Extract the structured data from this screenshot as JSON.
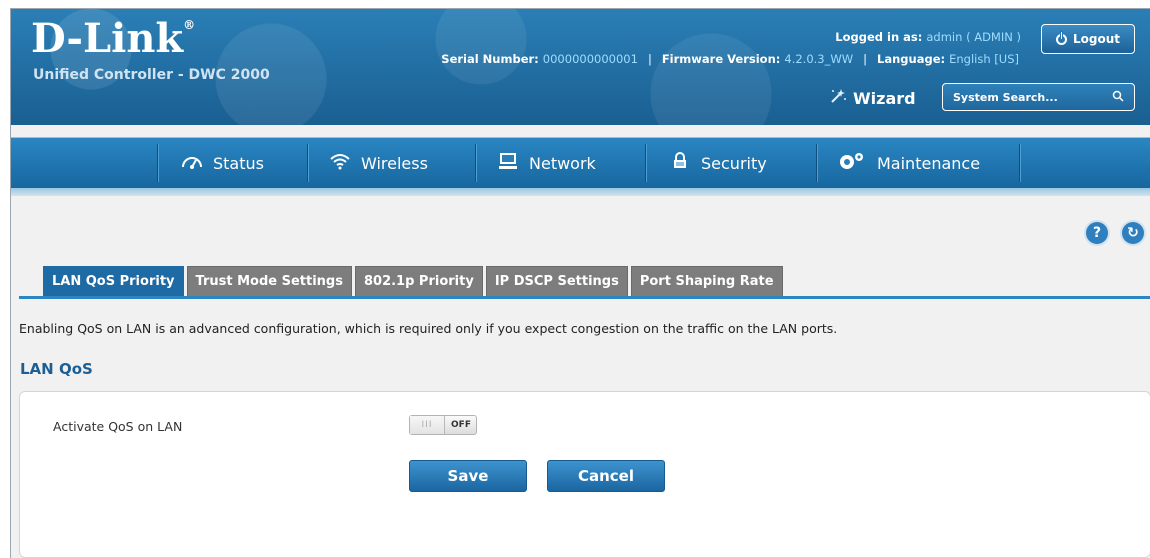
{
  "header": {
    "logo": "D-Link",
    "logo_mark": "®",
    "product": "Unified Controller - DWC 2000",
    "logged_in_label": "Logged in as:",
    "logged_in_user": "admin ( ADMIN )",
    "logout_label": "Logout",
    "serial_label": "Serial Number:",
    "serial_value": "0000000000001",
    "firmware_label": "Firmware Version:",
    "firmware_value": "4.2.0.3_WW",
    "language_label": "Language:",
    "language_value": "English [US]",
    "separator": "|",
    "wizard_label": "Wizard",
    "search_placeholder": "System Search...",
    "search_icon": "magnifier-icon"
  },
  "nav": {
    "items": [
      {
        "label": "Status",
        "icon": "gauge-icon"
      },
      {
        "label": "Wireless",
        "icon": "wifi-icon"
      },
      {
        "label": "Network",
        "icon": "monitor-icon"
      },
      {
        "label": "Security",
        "icon": "lock-icon"
      },
      {
        "label": "Maintenance",
        "icon": "gears-icon"
      }
    ]
  },
  "help": {
    "help_glyph": "?",
    "refresh_glyph": "↻"
  },
  "tabs": [
    {
      "label": "LAN QoS Priority",
      "active": true
    },
    {
      "label": "Trust Mode Settings",
      "active": false
    },
    {
      "label": "802.1p Priority",
      "active": false
    },
    {
      "label": "IP DSCP Settings",
      "active": false
    },
    {
      "label": "Port Shaping Rate",
      "active": false
    }
  ],
  "description": "Enabling QoS on LAN is an advanced configuration, which is required only if you expect congestion on the traffic on the LAN ports.",
  "section_title": "LAN QoS",
  "form": {
    "activate_label": "Activate QoS on LAN",
    "toggle_state": "OFF",
    "toggle_knob": "III",
    "save_label": "Save",
    "cancel_label": "Cancel"
  },
  "colors": {
    "brand_blue": "#1d6aa5",
    "tab_inactive": "#7d7d7d",
    "link_blue": "#9fdcff"
  }
}
